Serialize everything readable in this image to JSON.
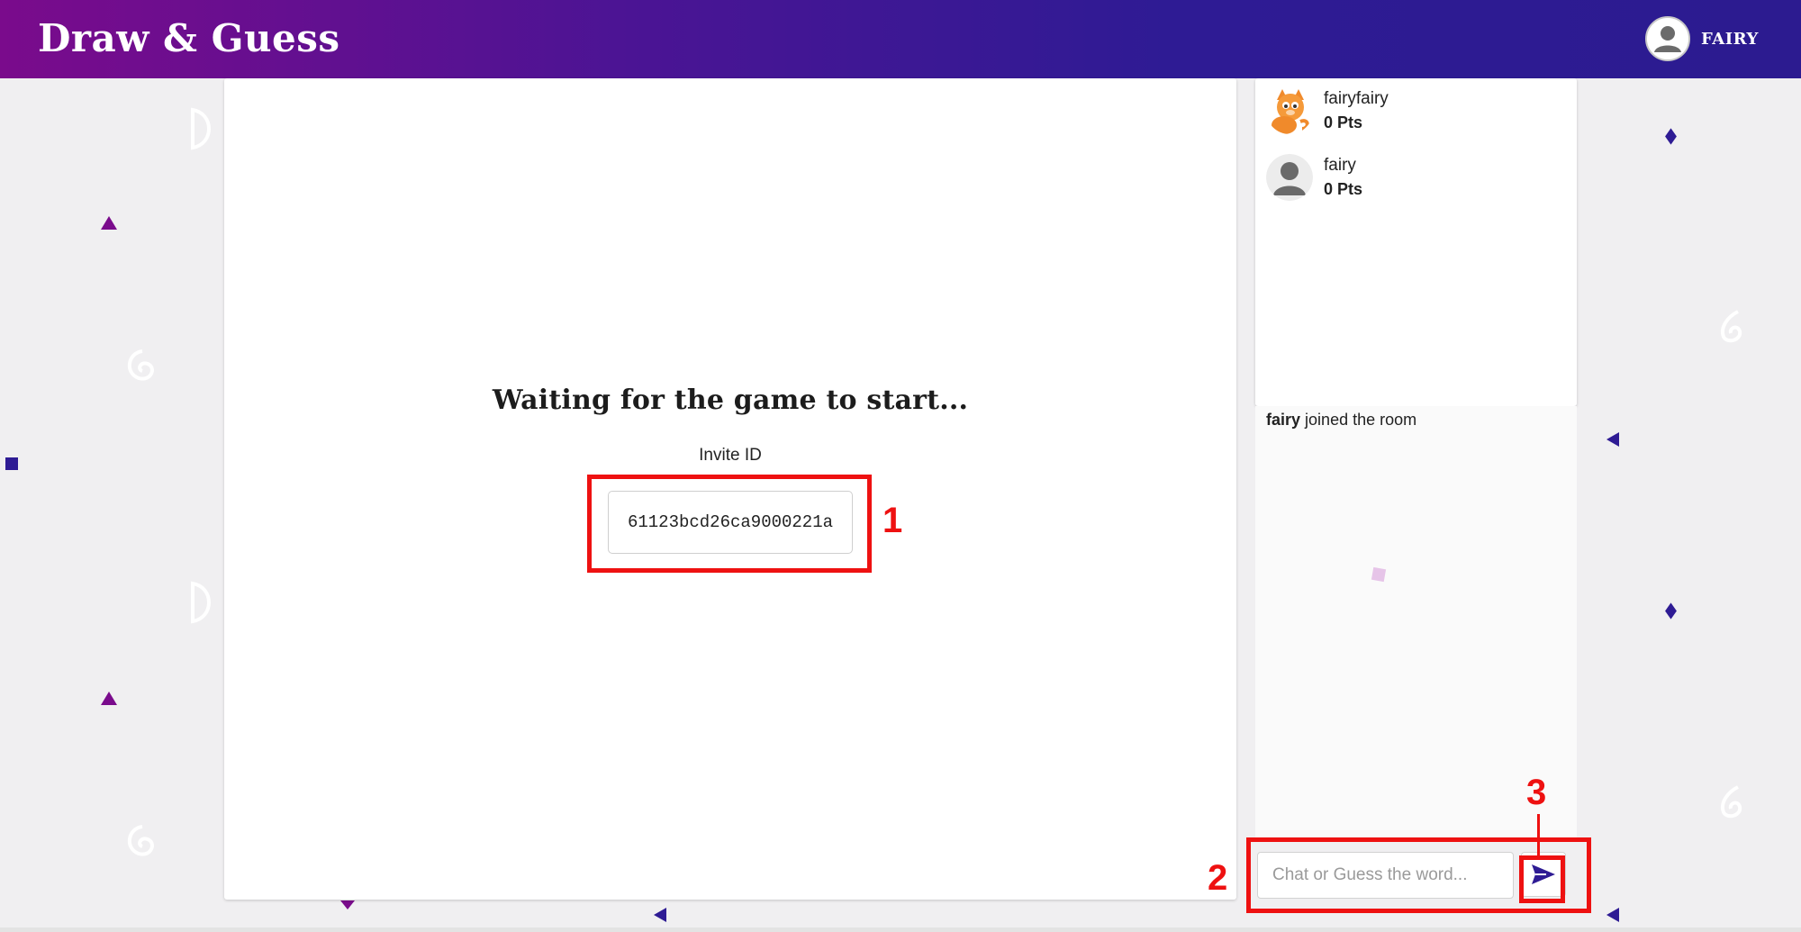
{
  "header": {
    "brand": "Draw & Guess",
    "user_name": "FAIRY"
  },
  "game": {
    "status": "Waiting for the game to start...",
    "invite_label": "Invite ID",
    "invite_id": "61123bcd26ca9000221a"
  },
  "players": [
    {
      "name": "fairyfairy",
      "score": "0 Pts",
      "avatar": "orange-cat-avatar"
    },
    {
      "name": "fairy",
      "score": "0 Pts",
      "avatar": "default-user-avatar"
    }
  ],
  "chat": {
    "messages": [
      {
        "user": "fairy",
        "text": "joined the room"
      }
    ],
    "input_placeholder": "Chat or Guess the word...",
    "send_icon": "send-icon"
  },
  "annotations": [
    "1",
    "2",
    "3"
  ],
  "colors": {
    "header_start": "#7a0b8c",
    "header_end": "#2c1b90",
    "accent": "#2e1b94",
    "annotation": "#ee1111"
  }
}
